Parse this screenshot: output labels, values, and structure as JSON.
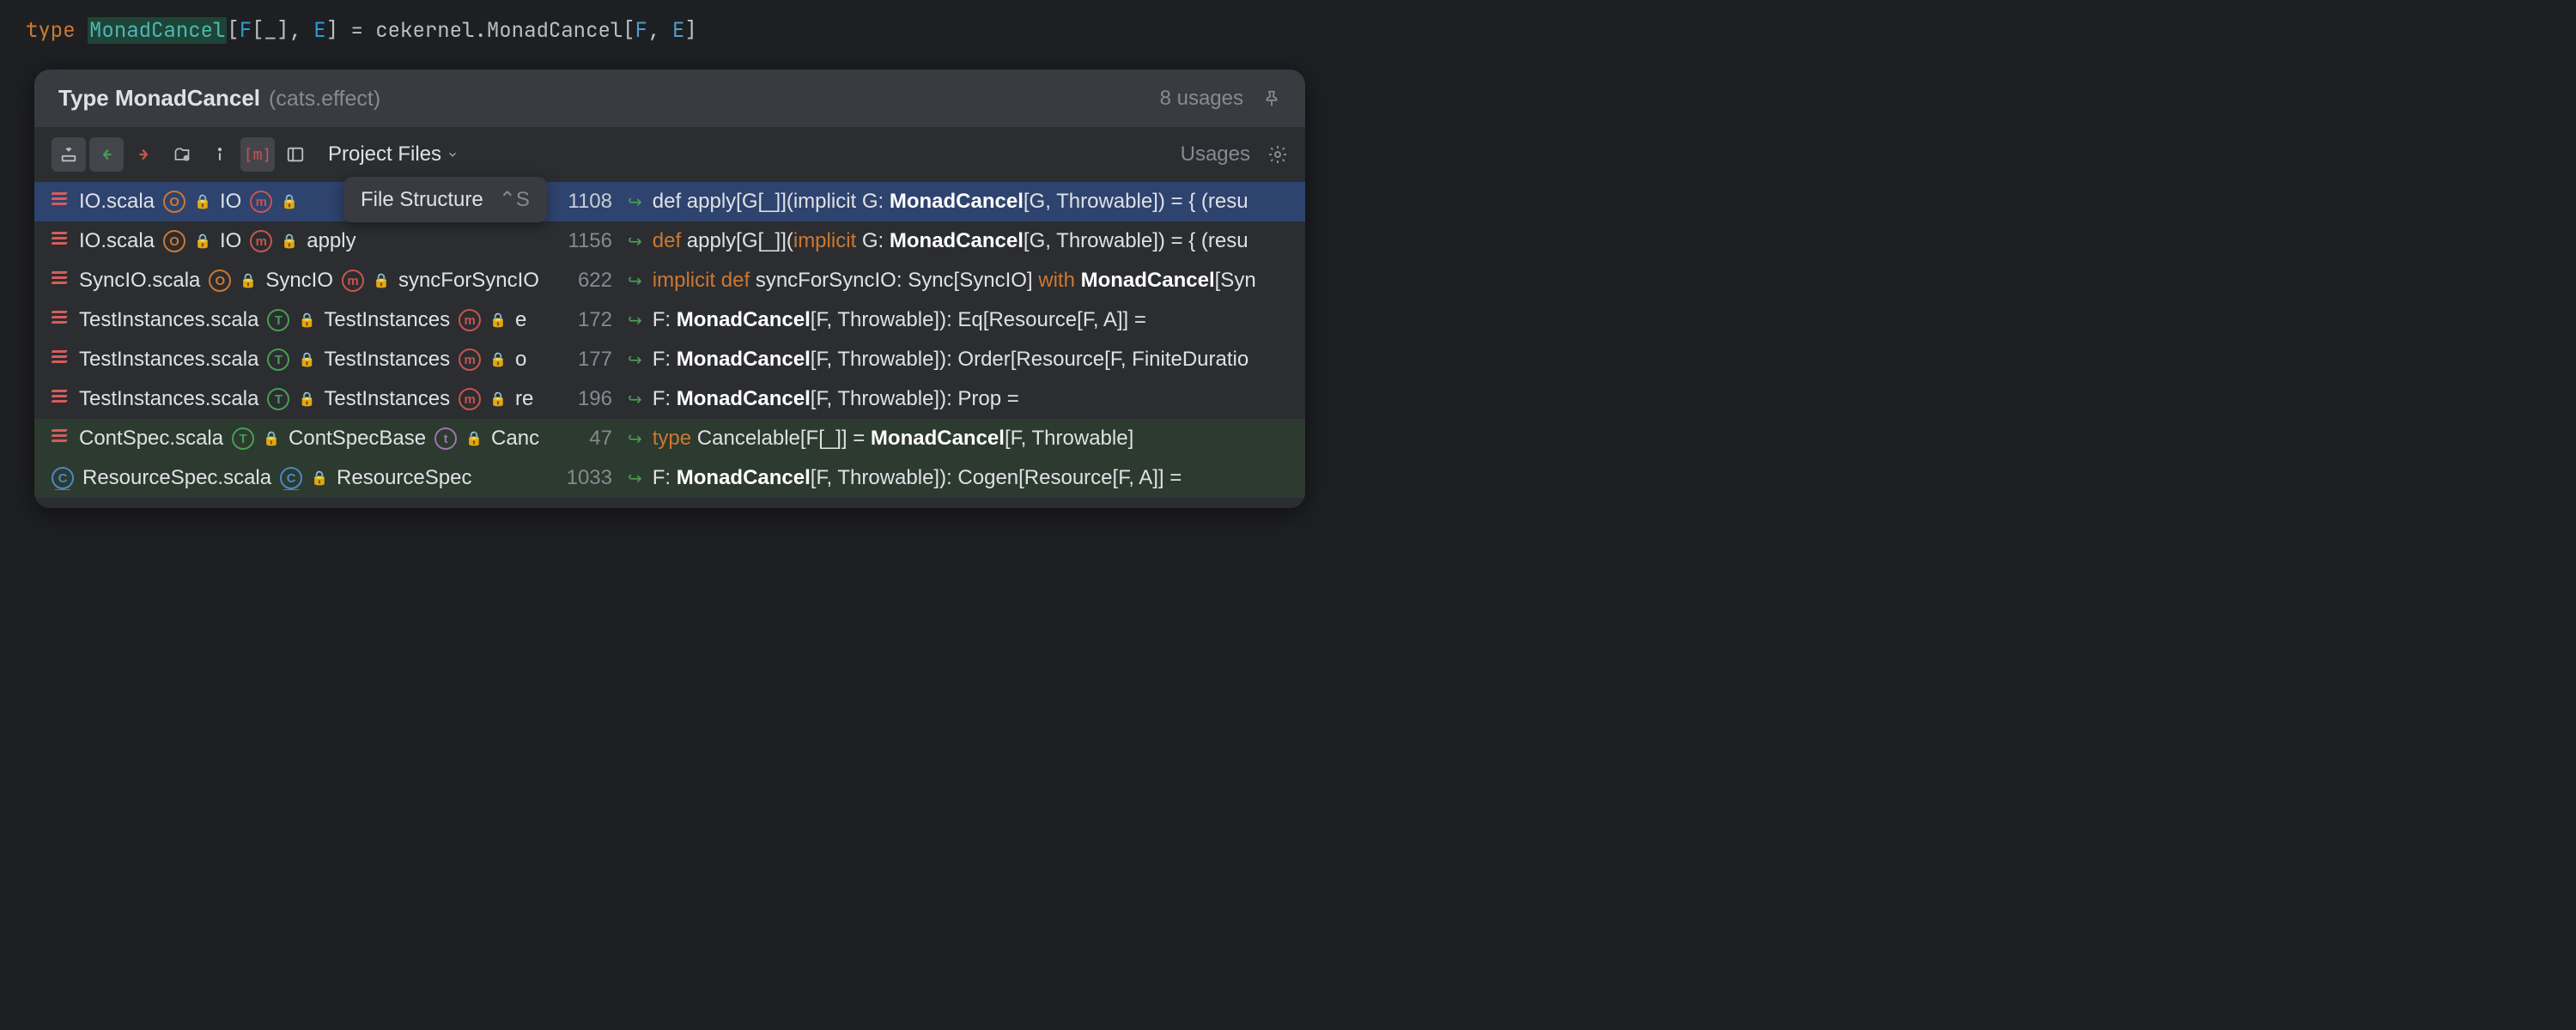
{
  "editor": {
    "kw": "type",
    "name": "MonadCancel",
    "sig_open": "[",
    "p1": "F",
    "p1_bound": "[_]",
    "comma1": ", ",
    "p2": "E",
    "sig_close": "]",
    "eq": " = ",
    "rhs_qual": "cekernel.MonadCancel[",
    "rhs_p1": "F",
    "rhs_comma": ", ",
    "rhs_p2": "E",
    "rhs_close": "]"
  },
  "popup": {
    "title": "Type MonadCancel",
    "qualifier": "(cats.effect)",
    "usage_count": "8 usages",
    "scope": "Project Files",
    "usages_label": "Usages"
  },
  "tooltip": {
    "text": "File Structure",
    "shortcut": "⌃S"
  },
  "rows": [
    {
      "file": "IO.scala",
      "container": {
        "kind": "O",
        "name": "IO"
      },
      "member": {
        "kind": "m",
        "name": ""
      },
      "line": "1108",
      "code_pre": "def apply[G[_]](implicit G: ",
      "code_hl": "MonadCancel",
      "code_post": "[G, Throwable]) = { (resu",
      "kw1": "",
      "kw2": ""
    },
    {
      "file": "IO.scala",
      "container": {
        "kind": "O",
        "name": "IO"
      },
      "member": {
        "kind": "m",
        "name": "apply"
      },
      "line": "1156",
      "code_pre_kw1": "def ",
      "code_mid1": "apply[G[_]](",
      "code_pre_kw2": "implicit ",
      "code_mid2": "G: ",
      "code_hl": "MonadCancel",
      "code_post": "[G, Throwable]) = { (resu"
    },
    {
      "file": "SyncIO.scala",
      "container": {
        "kind": "O",
        "name": "SyncIO"
      },
      "member": {
        "kind": "m",
        "name": "syncForSyncIO"
      },
      "line": "622",
      "code_pre_kw1": "implicit def ",
      "code_mid1": "syncForSyncIO: Sync[SyncIO] ",
      "code_pre_kw2": "with ",
      "code_mid2": "",
      "code_hl": "MonadCancel",
      "code_post": "[Syn"
    },
    {
      "file": "TestInstances.scala",
      "container": {
        "kind": "T",
        "name": "TestInstances"
      },
      "member": {
        "kind": "m",
        "name": "e"
      },
      "line": "172",
      "code_pre": "F: ",
      "code_hl": "MonadCancel",
      "code_post": "[F, Throwable]): Eq[Resource[F, A]] ="
    },
    {
      "file": "TestInstances.scala",
      "container": {
        "kind": "T",
        "name": "TestInstances"
      },
      "member": {
        "kind": "m",
        "name": "o"
      },
      "line": "177",
      "code_pre": "F: ",
      "code_hl": "MonadCancel",
      "code_post": "[F, Throwable]): Order[Resource[F, FiniteDuratio"
    },
    {
      "file": "TestInstances.scala",
      "container": {
        "kind": "T",
        "name": "TestInstances"
      },
      "member": {
        "kind": "m",
        "name": "re"
      },
      "line": "196",
      "code_pre": "F: ",
      "code_hl": "MonadCancel",
      "code_post": "[F, Throwable]): Prop ="
    },
    {
      "file": "ContSpec.scala",
      "container": {
        "kind": "T",
        "name": "ContSpecBase"
      },
      "member": {
        "kind": "t",
        "name": "Canc"
      },
      "line": "47",
      "code_pre_kw1": "type ",
      "code_mid1": "Cancelable[F[_]] = ",
      "code_hl": "MonadCancel",
      "code_post": "[F, Throwable]"
    },
    {
      "file": "ResourceSpec.scala",
      "container": {
        "kind": "C",
        "name": "ResourceSpec"
      },
      "member": null,
      "line": "1033",
      "code_pre": "F: ",
      "code_hl": "MonadCancel",
      "code_post": "[F, Throwable]): Cogen[Resource[F, A]] ="
    }
  ]
}
